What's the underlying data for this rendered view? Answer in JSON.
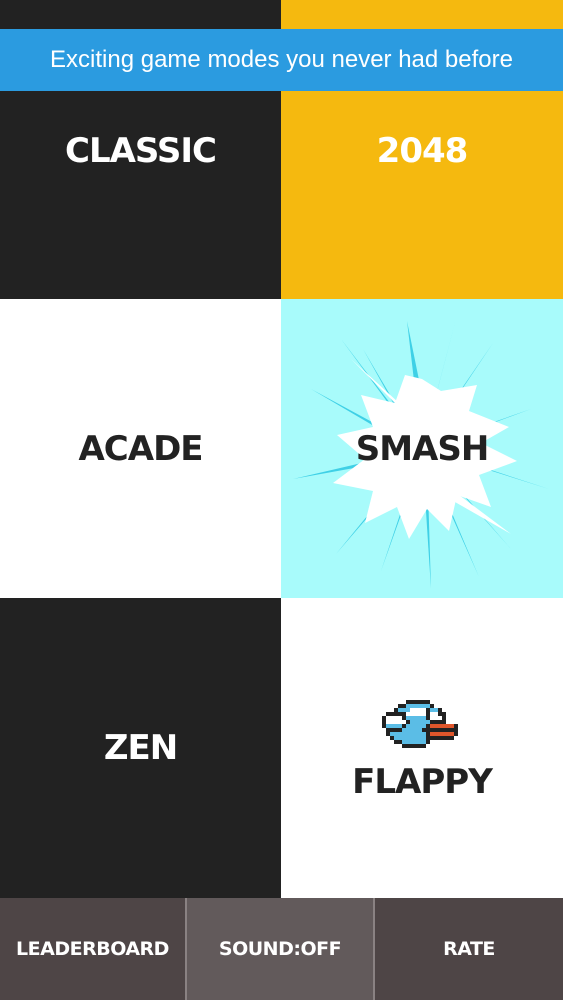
{
  "banner": {
    "text": "Exciting game modes you never had before"
  },
  "modes": {
    "classic": "CLASSIC",
    "m2048": "2048",
    "acade": "ACADE",
    "smash": "SMASH",
    "zen": "ZEN",
    "flappy": "FLAPPY"
  },
  "bottom_bar": {
    "leaderboard": "LEADERBOARD",
    "sound": "SOUND:OFF",
    "rate": "RATE"
  },
  "colors": {
    "black": "#222222",
    "yellow": "#f5b90f",
    "cyan": "#a8fbfb",
    "blue_banner": "#2b9be0",
    "bar_dark": "#4e4546",
    "bar_mid": "#625a5b"
  },
  "icons": {
    "smash_tile": "burst-icon",
    "flappy_tile": "bird-icon"
  }
}
